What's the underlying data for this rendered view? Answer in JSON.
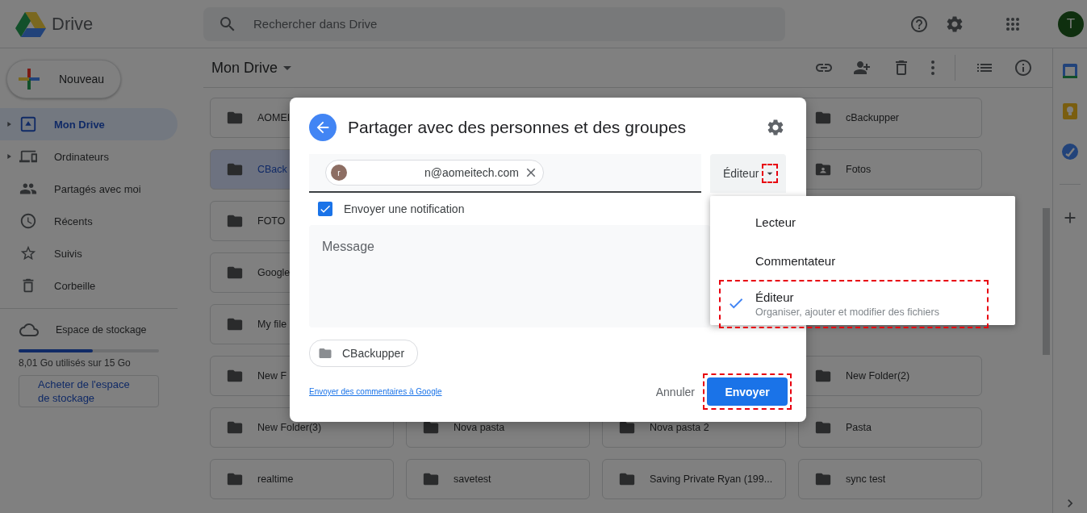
{
  "app": {
    "name": "Drive"
  },
  "search": {
    "placeholder": "Rechercher dans Drive"
  },
  "account": {
    "initial": "T"
  },
  "new_button": "Nouveau",
  "sidebar": {
    "items": [
      {
        "label": "Mon Drive",
        "selected": true,
        "expandable": true
      },
      {
        "label": "Ordinateurs",
        "selected": false,
        "expandable": true
      },
      {
        "label": "Partagés avec moi",
        "selected": false,
        "expandable": false
      },
      {
        "label": "Récents",
        "selected": false,
        "expandable": false
      },
      {
        "label": "Suivis",
        "selected": false,
        "expandable": false
      },
      {
        "label": "Corbeille",
        "selected": false,
        "expandable": false
      }
    ]
  },
  "storage": {
    "label": "Espace de stockage",
    "level": 0.53,
    "usage": "8,01 Go utilisés sur 15 Go",
    "buy_button": "Acheter de l'espace de stockage"
  },
  "breadcrumb": "Mon Drive",
  "folders": [
    {
      "column_1": {
        "name": "AOMEI",
        "shared": false,
        "selected": false
      },
      "column_4": {
        "name": "cBackupper",
        "shared": false,
        "selected": false
      }
    },
    {
      "column_1": {
        "name": "CBack",
        "shared": false,
        "selected": true
      },
      "column_4": {
        "name": "Fotos",
        "shared": true,
        "selected": false
      }
    },
    {
      "column_1": {
        "name": "FOTO",
        "shared": false,
        "selected": false
      }
    },
    {
      "column_1": {
        "name": "Google",
        "shared": false,
        "selected": false
      }
    },
    {
      "column_1": {
        "name": "My file",
        "shared": false,
        "selected": false
      }
    },
    {
      "column_1": {
        "name": "New F",
        "shared": false,
        "selected": false
      },
      "column_4": {
        "name": "New Folder(2)",
        "shared": false,
        "selected": false
      }
    },
    {
      "column_1": {
        "name": "New Folder(3)",
        "shared": false,
        "selected": false
      },
      "column_2": {
        "name": "Nova pasta",
        "shared": false,
        "selected": false
      },
      "column_3": {
        "name": "Nova pasta 2",
        "shared": false,
        "selected": false
      },
      "column_4": {
        "name": "Pasta",
        "shared": false,
        "selected": false
      }
    },
    {
      "column_1": {
        "name": "realtime",
        "shared": false,
        "selected": false
      },
      "column_2": {
        "name": "savetest",
        "shared": false,
        "selected": false
      },
      "column_3": {
        "name": "Saving Private Ryan (199...",
        "shared": false,
        "selected": false
      },
      "column_4": {
        "name": "sync test",
        "shared": false,
        "selected": false
      }
    }
  ],
  "dialog": {
    "title": "Partager avec des personnes et des groupes",
    "recipient": {
      "initial": "r",
      "email": "n@aomeitech.com"
    },
    "role": {
      "label": "Éditeur",
      "highlighted": true
    },
    "notify": {
      "label": "Envoyer une notification",
      "checked": true
    },
    "message": {
      "placeholder": "Message"
    },
    "item": "CBackupper",
    "feedback_link": "Envoyer des commentaires à Google",
    "cancel": "Annuler",
    "send": {
      "label": "Envoyer",
      "highlighted": true
    }
  },
  "role_menu": {
    "options": [
      {
        "label": "Lecteur",
        "selected": false,
        "highlighted": false
      },
      {
        "label": "Commentateur",
        "selected": false,
        "highlighted": false
      },
      {
        "label": "Éditeur",
        "description": "Organiser, ajouter et modifier des fichiers",
        "selected": true,
        "highlighted": true
      }
    ]
  }
}
